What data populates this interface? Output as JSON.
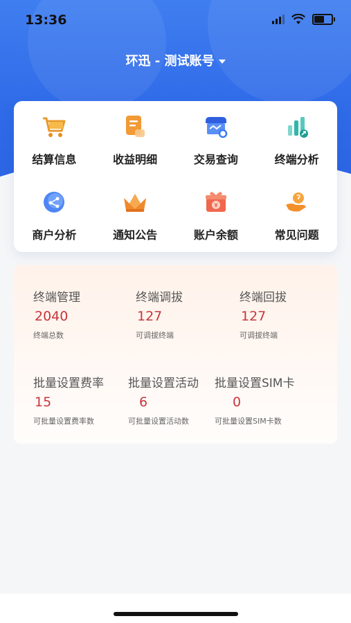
{
  "status": {
    "time": "13:36",
    "battery_level": 0.6
  },
  "header": {
    "account": "环迅 - 测试账号"
  },
  "colors": {
    "primary": "#2f6ae8",
    "value": "#c9353a",
    "icon_orange": "#f4a23c",
    "icon_blue": "#3b7cf2",
    "icon_teal": "#26b0a8"
  },
  "menu": [
    {
      "label": "结算信息",
      "icon": "cart-icon"
    },
    {
      "label": "收益明细",
      "icon": "document-icon"
    },
    {
      "label": "交易查询",
      "icon": "shop-search-icon"
    },
    {
      "label": "终端分析",
      "icon": "bar-chart-icon"
    },
    {
      "label": "商户分析",
      "icon": "share-icon"
    },
    {
      "label": "通知公告",
      "icon": "crown-icon"
    },
    {
      "label": "账户余额",
      "icon": "gift-money-icon"
    },
    {
      "label": "常见问题",
      "icon": "help-hand-icon"
    }
  ],
  "stats": [
    {
      "title": "终端管理",
      "value": "2040",
      "sub": "终端总数"
    },
    {
      "title": "终端调拔",
      "value": "127",
      "sub": "可调拔终端"
    },
    {
      "title": "终端回拔",
      "value": "127",
      "sub": "可调拔终端"
    },
    {
      "title": "批量设置费率",
      "value": "15",
      "sub": "可批量设置费率数"
    },
    {
      "title": "批量设置活动",
      "value": "6",
      "sub": "可批量设置活动数"
    },
    {
      "title": "批量设置SIM卡",
      "value": "0",
      "sub": "可批量设置SIM卡数"
    }
  ]
}
